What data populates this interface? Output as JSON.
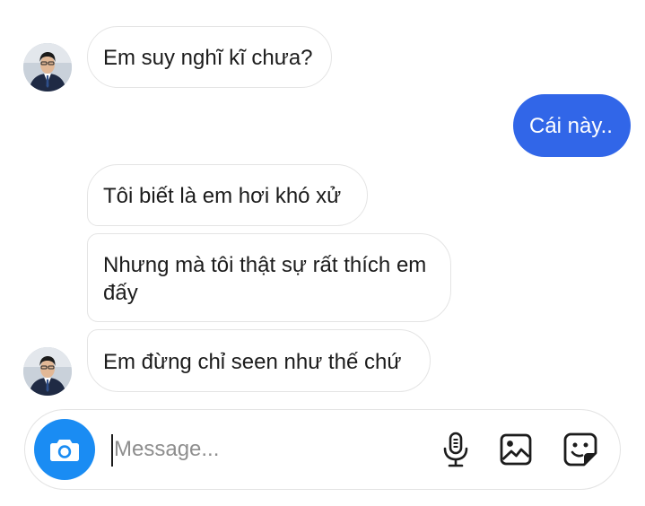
{
  "conversation": {
    "messages": [
      {
        "direction": "incoming",
        "text": "Em suy nghĩ kĩ chưa?"
      },
      {
        "direction": "outgoing",
        "text": "Cái này.."
      },
      {
        "direction": "incoming",
        "text": "Tôi biết là em hơi khó xử"
      },
      {
        "direction": "incoming",
        "text": "Nhưng mà tôi thật sự rất thích em đấy"
      },
      {
        "direction": "incoming",
        "text": "Em đừng chỉ seen như thế chứ"
      }
    ]
  },
  "composer": {
    "placeholder": "Message...",
    "value": ""
  },
  "icons": {
    "camera": "camera-icon",
    "microphone": "microphone-icon",
    "gallery": "image-icon",
    "sticker": "sticker-icon"
  },
  "colors": {
    "outgoing_bubble": "#3166e8",
    "camera_button": "#1a8cf3",
    "incoming_border": "#e4e4e4",
    "text": "#1c1c1c",
    "placeholder": "#8e8e8e"
  }
}
